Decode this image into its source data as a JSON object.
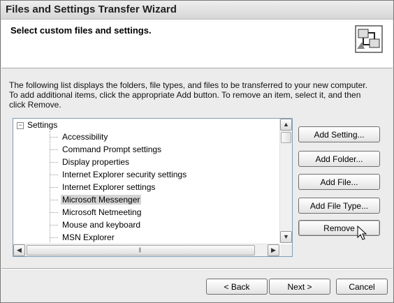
{
  "window": {
    "title": "Files and Settings Transfer Wizard"
  },
  "header": {
    "title": "Select custom files and settings."
  },
  "description": {
    "line1": "The following list displays the folders, file types, and files to be transferred to your new computer.",
    "line2": "To add additional items, click the appropriate Add button. To remove an item, select it, and then",
    "line3": "click Remove."
  },
  "tree": {
    "root_label": "Settings",
    "items": [
      "Accessibility",
      "Command Prompt settings",
      "Display properties",
      "Internet Explorer security settings",
      "Internet Explorer settings",
      "Microsoft Messenger",
      "Microsoft Netmeeting",
      "Mouse and keyboard",
      "MSN Explorer"
    ],
    "selected": "Microsoft Messenger"
  },
  "side_buttons": {
    "add_setting": "Add Setting...",
    "add_folder": "Add Folder...",
    "add_file": "Add File...",
    "add_file_type": "Add File Type...",
    "remove": "Remove"
  },
  "footer": {
    "back": "< Back",
    "next": "Next >",
    "cancel": "Cancel"
  },
  "icons": [
    "wizard-icon",
    "expander-icon",
    "scroll-up-icon",
    "scroll-down-icon",
    "scroll-left-icon",
    "scroll-right-icon",
    "mouse-pointer-icon"
  ]
}
